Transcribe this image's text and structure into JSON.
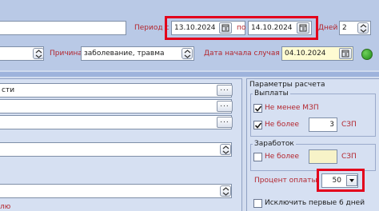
{
  "header": {
    "period_label": "Период с",
    "date_from": "13.10.2024",
    "period_to_label": "по",
    "date_to": "14.10.2024",
    "days_label": "Дней",
    "days_value": "2"
  },
  "reason_row": {
    "reason_label": "Причина",
    "reason_value": "заболевание, травма",
    "start_label": "Дата начала случая",
    "start_date": "04.10.2024"
  },
  "left_fields": {
    "field1_text": "сти",
    "field_last_text": "лю"
  },
  "calc_params": {
    "title": "Параметры расчета",
    "payments": {
      "title": "Выплаты",
      "min_wage_label": "Не менее МЗП",
      "min_wage_checked": true,
      "not_more_label": "Не более",
      "not_more_checked": true,
      "not_more_value": "3",
      "not_more_unit": "СЗП"
    },
    "earnings": {
      "title": "Заработок",
      "not_more_label": "Не более",
      "not_more_checked": false,
      "not_more_value": "",
      "not_more_unit": "СЗП"
    },
    "payment_percent_label": "Процент оплаты",
    "payment_percent_value": "50",
    "exclude_label": "Исключить первые 6 дней",
    "exclude_checked": false
  },
  "icons": {
    "calendar": "calendar-icon",
    "spin": "spin-icon",
    "dropdown": "chevron-down-icon",
    "status": "green-status-icon"
  },
  "colors": {
    "highlight": "#e3001b",
    "label_red": "#b3262e",
    "status_green": "#1e8c18"
  }
}
